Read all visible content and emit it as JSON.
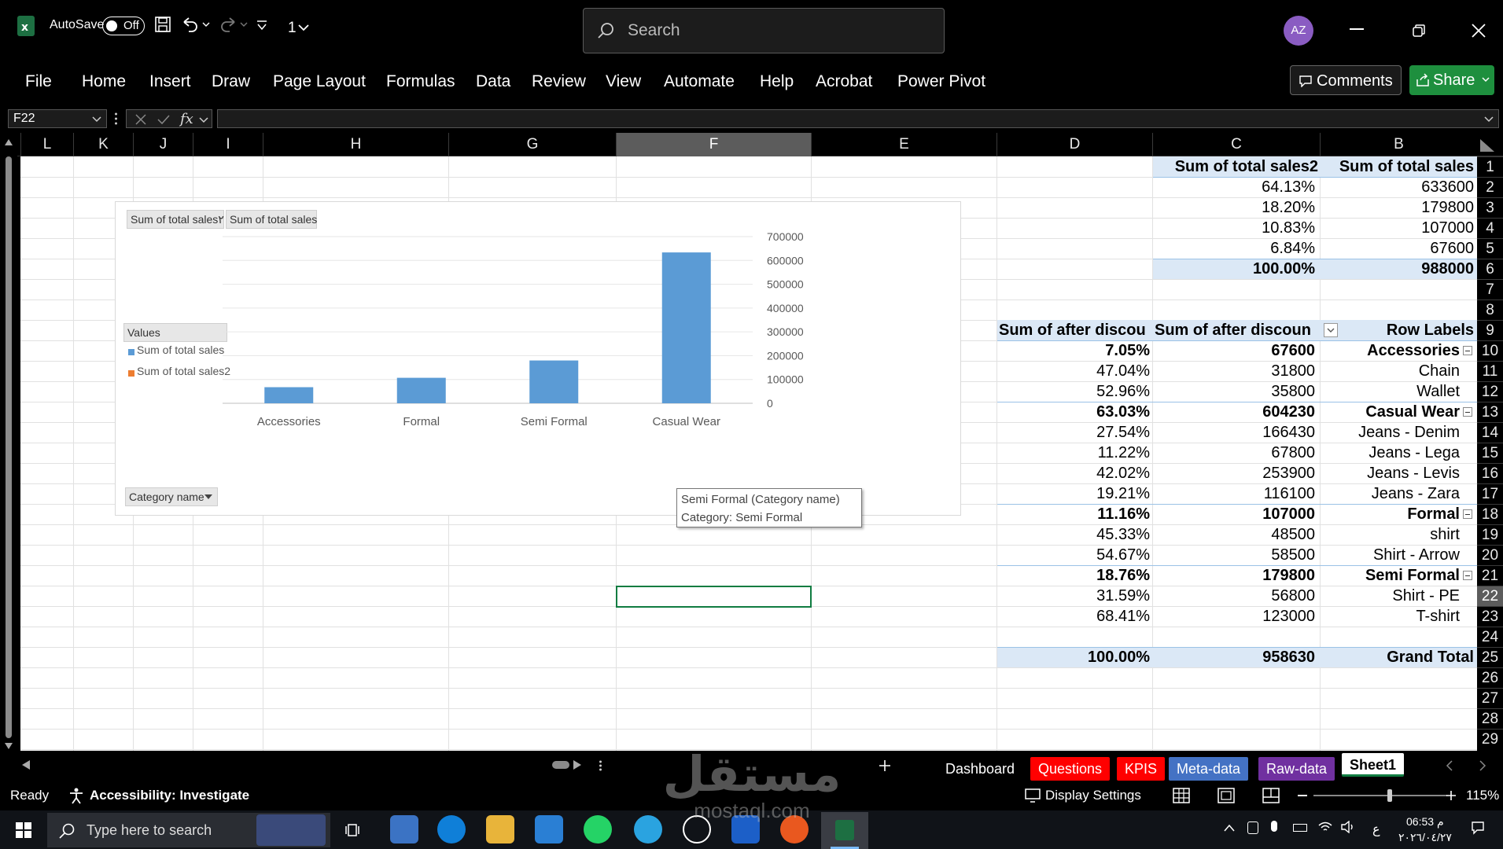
{
  "titlebar": {
    "autosave_label": "AutoSave",
    "autosave_state": "Off",
    "qat_number": "1",
    "search_placeholder": "Search",
    "avatar_initials": "AZ"
  },
  "ribbon": {
    "tabs": [
      "File",
      "Home",
      "Insert",
      "Draw",
      "Page Layout",
      "Formulas",
      "Data",
      "Review",
      "View",
      "Automate",
      "Help",
      "Acrobat",
      "Power Pivot"
    ],
    "comments_label": "Comments",
    "share_label": "Share",
    "share_color": "#1e8f3e"
  },
  "formula": {
    "name_box": "F22",
    "fx_label": "fx",
    "content": ""
  },
  "columns": [
    "L",
    "K",
    "J",
    "I",
    "H",
    "G",
    "F",
    "E",
    "D",
    "C",
    "B"
  ],
  "selected_column": "F",
  "rows": [
    "1",
    "2",
    "3",
    "4",
    "5",
    "6",
    "7",
    "8",
    "9",
    "10",
    "11",
    "12",
    "13",
    "14",
    "15",
    "16",
    "17",
    "18",
    "19",
    "20",
    "21",
    "22",
    "23",
    "24",
    "25",
    "26",
    "27",
    "28",
    "29"
  ],
  "selected_row": "22",
  "pivot1": {
    "headers": [
      "Sum of total sales2",
      "Sum of total sales"
    ],
    "rows": [
      [
        "64.13%",
        "633600"
      ],
      [
        "18.20%",
        "179800"
      ],
      [
        "10.83%",
        "107000"
      ],
      [
        "6.84%",
        "67600"
      ]
    ],
    "total": [
      "100.00%",
      "988000"
    ]
  },
  "pivot2": {
    "headers": [
      "Sum of after discou",
      "Sum of after discoun",
      "Row Labels"
    ],
    "rows": [
      {
        "d": "7.05%",
        "c": "67600",
        "b": "Accessories",
        "bold": true
      },
      {
        "d": "47.04%",
        "c": "31800",
        "b": "Chain",
        "bold": false
      },
      {
        "d": "52.96%",
        "c": "35800",
        "b": "Wallet",
        "bold": false
      },
      {
        "d": "63.03%",
        "c": "604230",
        "b": "Casual Wear",
        "bold": true
      },
      {
        "d": "27.54%",
        "c": "166430",
        "b": "Jeans - Denim",
        "bold": false
      },
      {
        "d": "11.22%",
        "c": "67800",
        "b": "Jeans - Lega",
        "bold": false
      },
      {
        "d": "42.02%",
        "c": "253900",
        "b": "Jeans - Levis",
        "bold": false
      },
      {
        "d": "19.21%",
        "c": "116100",
        "b": "Jeans - Zara",
        "bold": false
      },
      {
        "d": "11.16%",
        "c": "107000",
        "b": "Formal",
        "bold": true
      },
      {
        "d": "45.33%",
        "c": "48500",
        "b": "shirt",
        "bold": false
      },
      {
        "d": "54.67%",
        "c": "58500",
        "b": "Shirt - Arrow",
        "bold": false
      },
      {
        "d": "18.76%",
        "c": "179800",
        "b": "Semi Formal",
        "bold": true
      },
      {
        "d": "31.59%",
        "c": "56800",
        "b": "Shirt - PE",
        "bold": false
      },
      {
        "d": "68.41%",
        "c": "123000",
        "b": "T-shirt",
        "bold": false
      }
    ],
    "total": {
      "d": "100.00%",
      "c": "958630",
      "b": "Grand Total"
    }
  },
  "chart_data": {
    "type": "bar",
    "categories": [
      "Accessories",
      "Formal",
      "Semi Formal",
      "Casual Wear"
    ],
    "series": [
      {
        "name": "Sum of total sales",
        "values": [
          67600,
          107000,
          179800,
          633600
        ],
        "color": "#5b9bd5"
      },
      {
        "name": "Sum of total sales2",
        "values": [
          0.0684,
          0.1083,
          0.182,
          0.6413
        ],
        "color": "#ed7d31"
      }
    ],
    "ylim": [
      0,
      700000
    ],
    "yticks": [
      "700000",
      "600000",
      "500000",
      "400000",
      "300000",
      "200000",
      "100000",
      "0"
    ],
    "legend_title": "Values",
    "legend_position": "left",
    "field_buttons": [
      "Sum of total sales٢",
      "Sum of total sales"
    ],
    "axis_field": "Category name",
    "y_axis_side": "right",
    "grid": true
  },
  "tooltip": {
    "line1": "Semi Formal (Category name)",
    "line2": "Category: Semi Formal"
  },
  "sheets": {
    "tabs": [
      {
        "label": "Dashboard",
        "color": "#000000"
      },
      {
        "label": "Questions",
        "color": "#ff0000"
      },
      {
        "label": "KPIS",
        "color": "#ff0000"
      },
      {
        "label": "Meta-data",
        "color": "#4472c4"
      },
      {
        "label": "Raw-data",
        "color": "#7030a0"
      },
      {
        "label": "Sheet1",
        "color": "#ffffff"
      }
    ],
    "active": "Sheet1"
  },
  "status": {
    "ready": "Ready",
    "accessibility": "Accessibility: Investigate",
    "display_settings": "Display Settings",
    "zoom": "115%",
    "zoom_level": 0.57
  },
  "taskbar": {
    "search_placeholder": "Type here to search",
    "time": "06:53 م",
    "date": "٢٠٢٦/٠٤/٢٧",
    "lang": "ع"
  },
  "watermark": {
    "text_ar": "مستقل",
    "text_en": "mostaql.com"
  }
}
